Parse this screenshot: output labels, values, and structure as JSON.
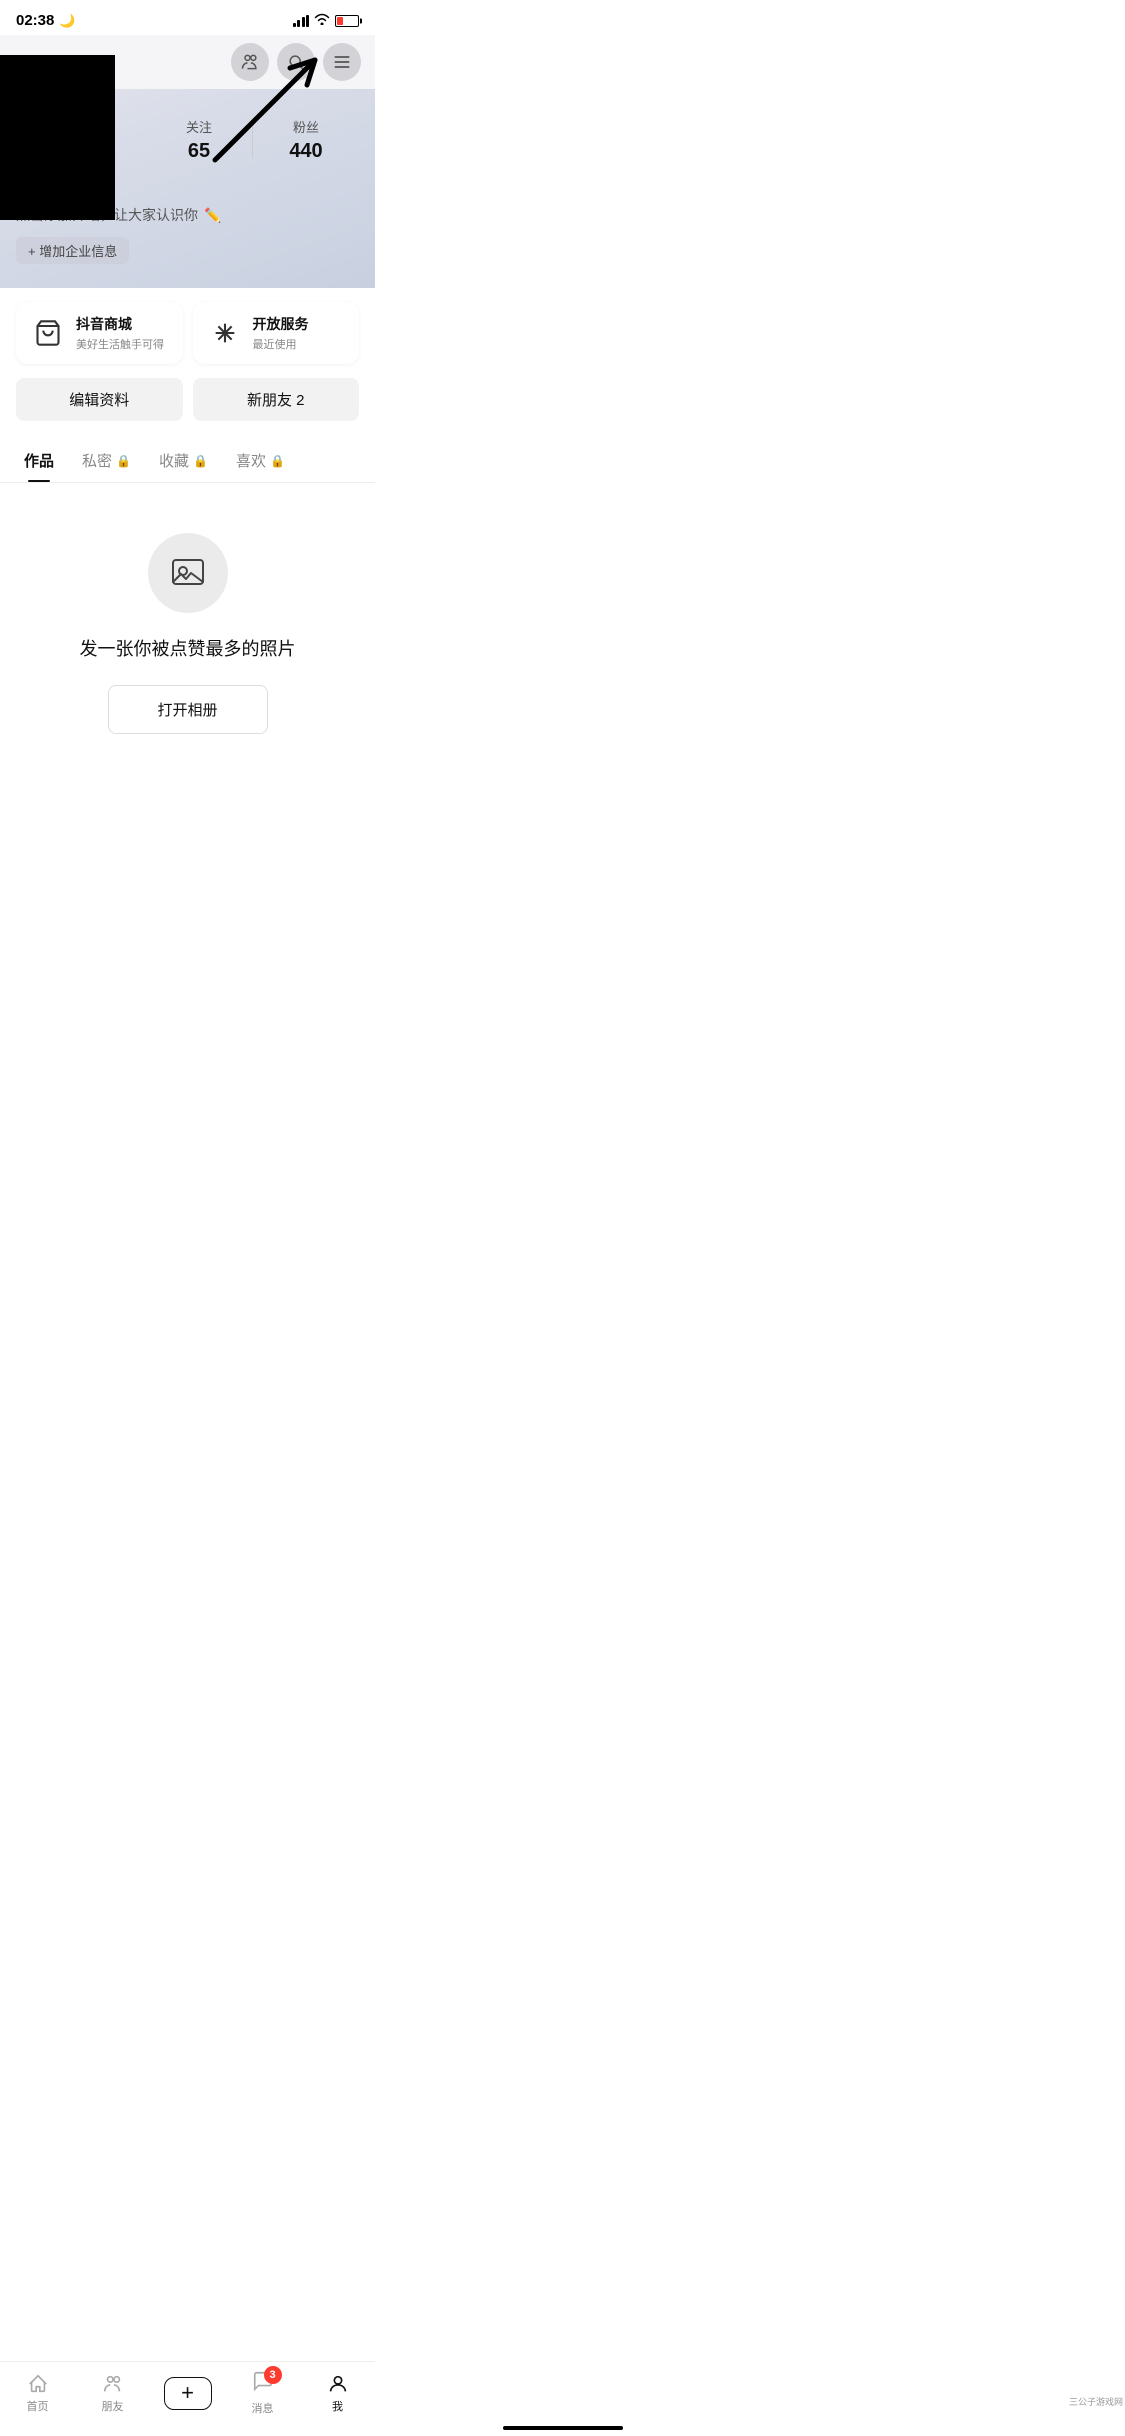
{
  "statusBar": {
    "time": "02:38",
    "moonIcon": "🌙"
  },
  "header": {
    "friendsIcon": "friends",
    "searchIcon": "search",
    "menuIcon": "menu"
  },
  "profile": {
    "followLabel": "关注",
    "followCount": "65",
    "fansLabel": "粉丝",
    "fansCount": "440",
    "bio": "点击添加介绍，让大家认识你",
    "addCompanyLabel": "+ 增加企业信息"
  },
  "services": [
    {
      "title": "抖音商城",
      "subtitle": "美好生活触手可得",
      "icon": "cart"
    },
    {
      "title": "开放服务",
      "subtitle": "最近使用",
      "icon": "asterisk"
    }
  ],
  "actionButtons": {
    "editProfile": "编辑资料",
    "newFriends": "新朋友 2"
  },
  "tabs": [
    {
      "label": "作品",
      "active": true,
      "lock": false
    },
    {
      "label": "私密",
      "active": false,
      "lock": true
    },
    {
      "label": "收藏",
      "active": false,
      "lock": true
    },
    {
      "label": "喜欢",
      "active": false,
      "lock": true
    }
  ],
  "emptyState": {
    "title": "发一张你被点赞最多的照片",
    "buttonLabel": "打开相册"
  },
  "bottomNav": {
    "home": "首页",
    "friends": "朋友",
    "plus": "+",
    "messages": "消息",
    "messageBadge": "3",
    "profile": "我"
  },
  "annotation": {
    "arrowTarget": "menu-button"
  },
  "watermark": "三公子游戏网"
}
